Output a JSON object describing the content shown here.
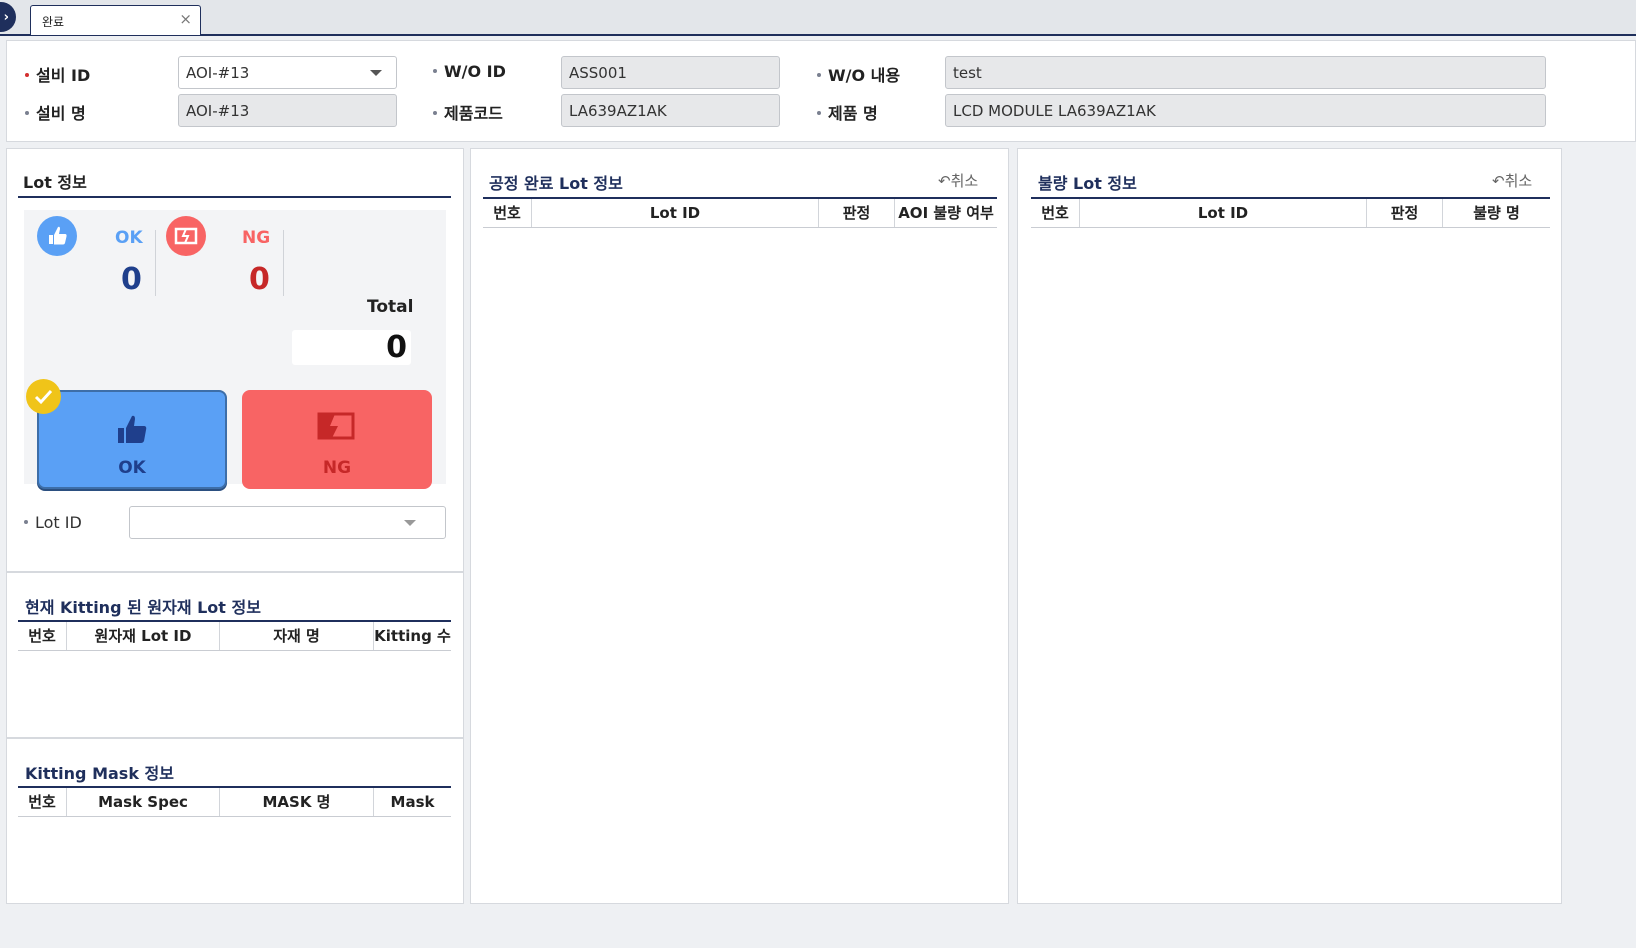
{
  "tab": {
    "label": "완료",
    "close": "×"
  },
  "header": {
    "equip_id_label": "설비 ID",
    "equip_id_value": "AOI-#13",
    "equip_name_label": "설비 명",
    "equip_name_value": "AOI-#13",
    "wo_id_label": "W/O ID",
    "wo_id_value": "ASS001",
    "product_code_label": "제품코드",
    "product_code_value": "LA639AZ1AK",
    "wo_content_label": "W/O 내용",
    "wo_content_value": "test",
    "product_name_label": "제품 명",
    "product_name_value": "LCD MODULE LA639AZ1AK"
  },
  "lot_info": {
    "title": "Lot 정보",
    "ok_label": "OK",
    "ok_count": "0",
    "ng_label": "NG",
    "ng_count": "0",
    "total_label": "Total",
    "total_count": "0",
    "ok_button": "OK",
    "ng_button": "NG",
    "lot_id_label": "Lot ID",
    "lot_id_value": ""
  },
  "kitting_material": {
    "title": "현재 Kitting 된 원자재 Lot 정보",
    "columns": [
      "번호",
      "원자재 Lot ID",
      "자재 명",
      "Kitting 수"
    ]
  },
  "kitting_mask": {
    "title": "Kitting Mask 정보",
    "columns": [
      "번호",
      "Mask Spec",
      "MASK 명",
      "Mask"
    ]
  },
  "process_done": {
    "title": "공정 완료 Lot 정보",
    "cancel": "취소",
    "columns": [
      "번호",
      "Lot ID",
      "판정",
      "AOI 불량 여부"
    ]
  },
  "defect_lot": {
    "title": "불량 Lot 정보",
    "cancel": "취소",
    "columns": [
      "번호",
      "Lot ID",
      "판정",
      "불량 명"
    ]
  },
  "colors": {
    "navy": "#1f2f5c",
    "ok_blue": "#5aa0f5",
    "ng_red": "#f86464",
    "check_yellow": "#f0c419"
  }
}
